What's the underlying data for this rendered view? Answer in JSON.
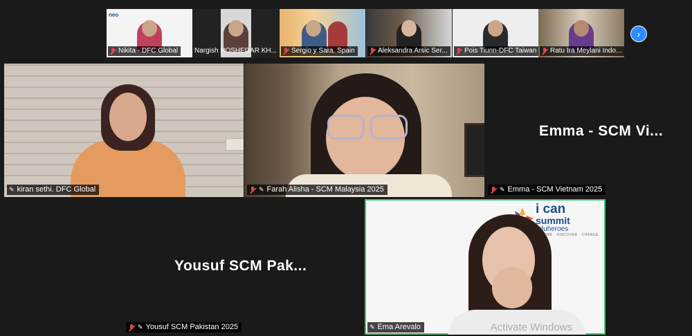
{
  "strip": {
    "thumbs": [
      {
        "name": "Nikita - DFC Global",
        "muted": true
      },
      {
        "name": "Nargish HOSHEDAR KH...",
        "muted": false
      },
      {
        "name": "Sergio y Sara. Spain",
        "muted": true
      },
      {
        "name": "Aleksandra Arsic Ser...",
        "muted": true
      },
      {
        "name": "Pois Tiunn-DFC Taiwan",
        "muted": true
      },
      {
        "name": "Ratu Ira Meylani Indo...",
        "muted": true
      }
    ],
    "next_icon": "chevron-right-icon",
    "thumb_logo_text": "neo"
  },
  "tiles": {
    "kiran": {
      "label": "kiran sethi. DFC Global",
      "muted": false
    },
    "farah": {
      "label": "Farah Alisha - SCM Malaysia 2025",
      "muted": true
    },
    "emma": {
      "label": "Emma - SCM Vietnam 2025",
      "display_name": "Emma - SCM Vi...",
      "muted": true
    },
    "yousuf": {
      "label": "Yousuf SCM Pakistan 2025",
      "display_name": "Yousuf SCM Pak...",
      "muted": true
    },
    "ema": {
      "label": "Ema Arevalo",
      "muted": false
    }
  },
  "logo": {
    "line1": "i can",
    "line2": "summit",
    "line3": "eduheroes",
    "line4": "IMAGINE · DISCOVER · CHANGE"
  },
  "watermark": "Activate Windows",
  "colors": {
    "mic_off": "#e0454b",
    "active_speaker": "#3fc37a",
    "next_button": "#2d8cff"
  }
}
